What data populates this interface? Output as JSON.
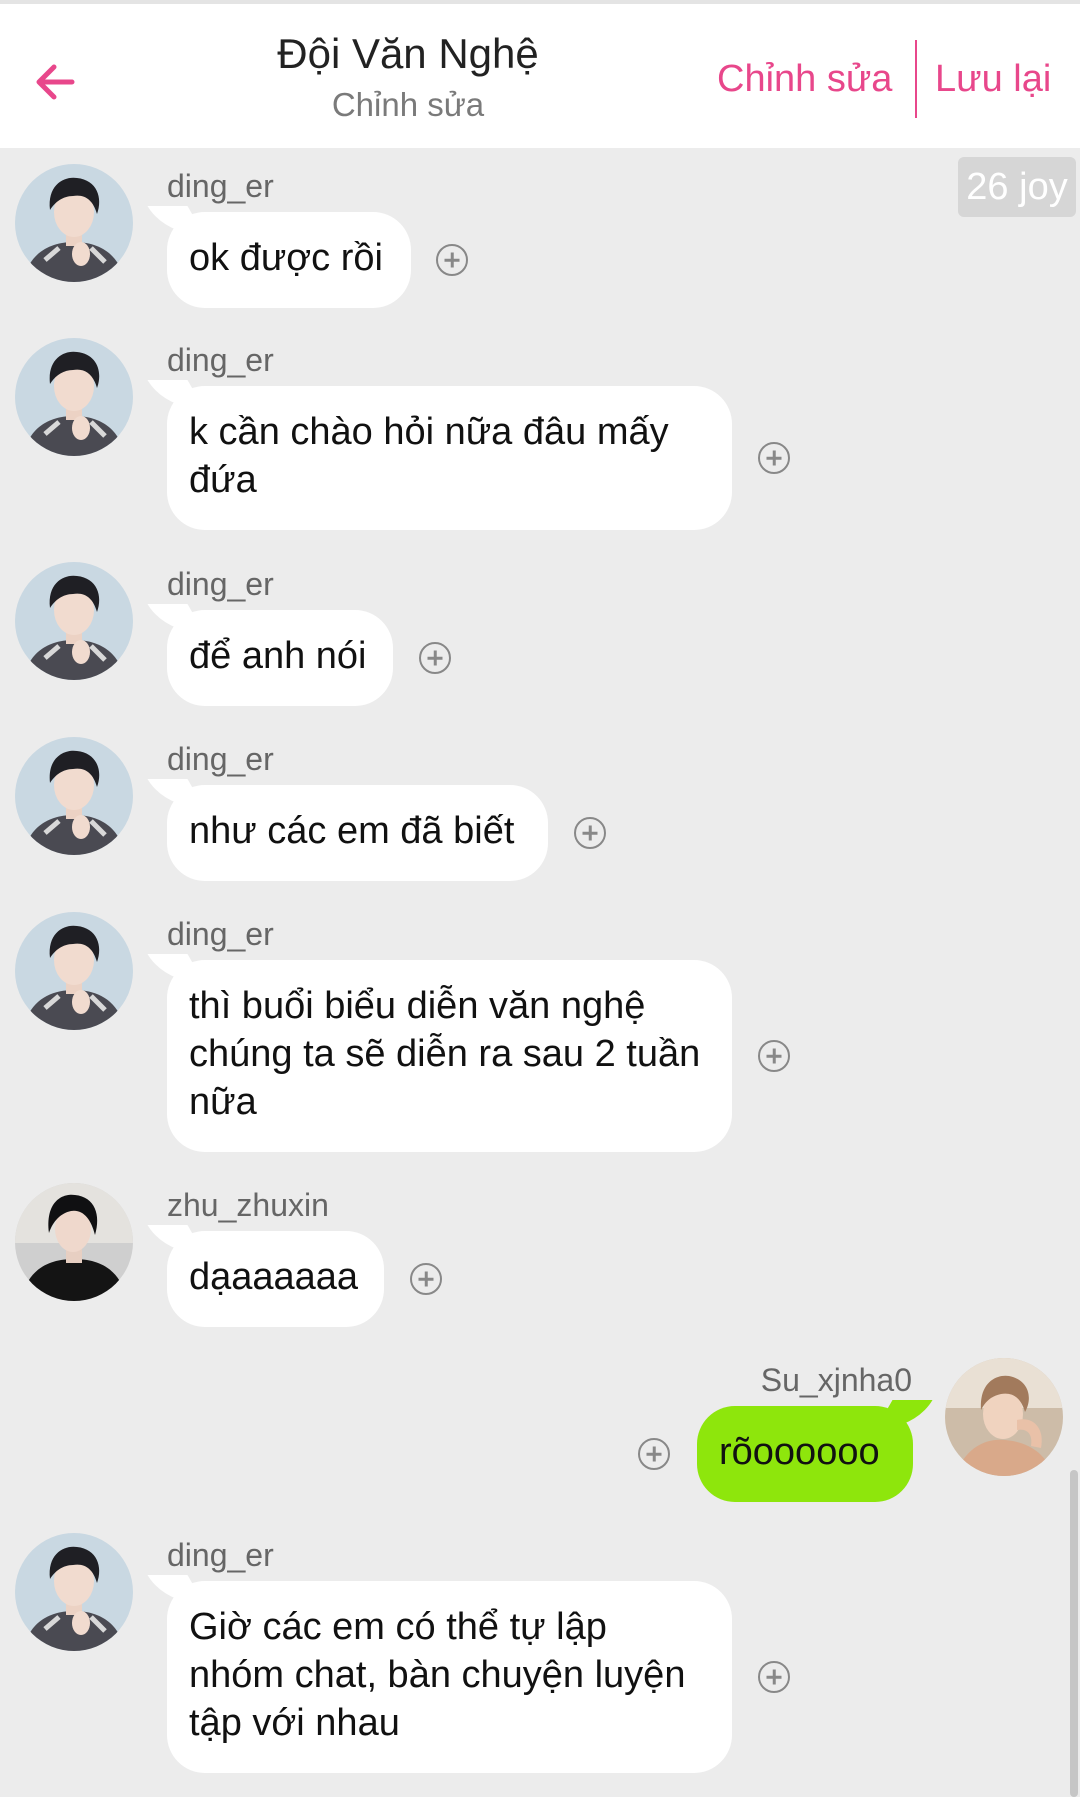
{
  "header": {
    "title": "Đội Văn Nghệ",
    "subtitle": "Chỉnh sửa",
    "edit_label": "Chỉnh sửa",
    "save_label": "Lưu lại",
    "accent_color": "#e8478b"
  },
  "badge": {
    "label": "26 joy"
  },
  "messages": [
    {
      "sender": "ding_er",
      "text": "ok được rồi",
      "side": "left"
    },
    {
      "sender": "ding_er",
      "text": "k cần chào hỏi nữa đâu mấy đứa",
      "side": "left"
    },
    {
      "sender": "ding_er",
      "text": "để anh nói",
      "side": "left"
    },
    {
      "sender": "ding_er",
      "text": "như các em đã biết",
      "side": "left"
    },
    {
      "sender": "ding_er",
      "text": "thì buổi biểu diễn văn nghệ chúng ta sẽ diễn ra sau 2 tuần nữa",
      "side": "left"
    },
    {
      "sender": "zhu_zhuxin",
      "text": "dạaaaaaa",
      "side": "left"
    },
    {
      "sender": "Su_xjnha0",
      "text": "rõoooooo",
      "side": "right"
    },
    {
      "sender": "ding_er",
      "text": "Giờ các em có thể tự lập nhóm chat, bàn chuyện luyện tập với nhau",
      "side": "left"
    }
  ],
  "colors": {
    "chat_background": "#ececec",
    "own_bubble": "#8ee60c",
    "other_bubble": "#ffffff"
  }
}
